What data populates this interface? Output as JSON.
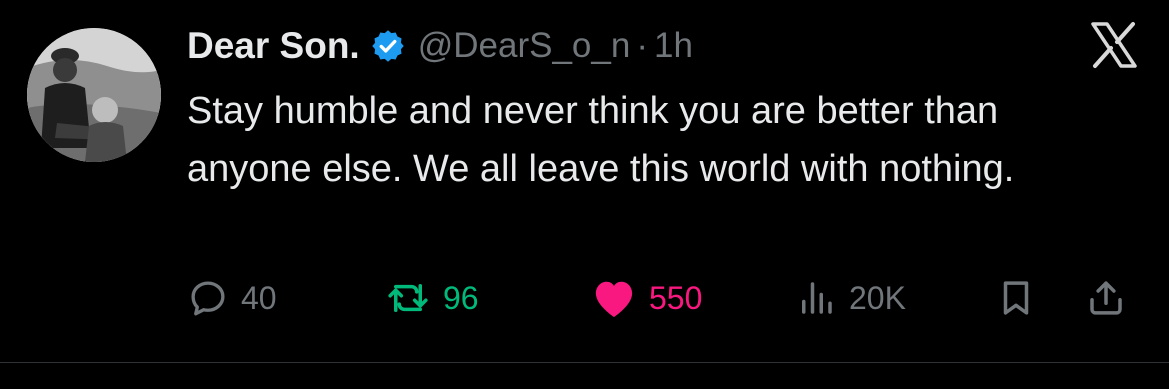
{
  "tweet": {
    "author_name": "Dear Son.",
    "handle": "@DearS_o_n",
    "separator": "·",
    "time": "1h",
    "text": "Stay humble and never think you are better than anyone else. We all leave this world with nothing."
  },
  "metrics": {
    "replies": "40",
    "retweets": "96",
    "likes": "550",
    "views": "20K"
  },
  "icons": {
    "verified": "verified-badge-icon",
    "brand": "x-logo-icon",
    "reply": "reply-icon",
    "retweet": "retweet-icon",
    "like": "heart-icon",
    "views": "views-icon",
    "bookmark": "bookmark-icon",
    "share": "share-icon"
  },
  "colors": {
    "background": "#000000",
    "text": "#e7e9ea",
    "muted": "#71767b",
    "verified": "#1d9bf0",
    "retweet": "#00ba7c",
    "like": "#f91880"
  }
}
